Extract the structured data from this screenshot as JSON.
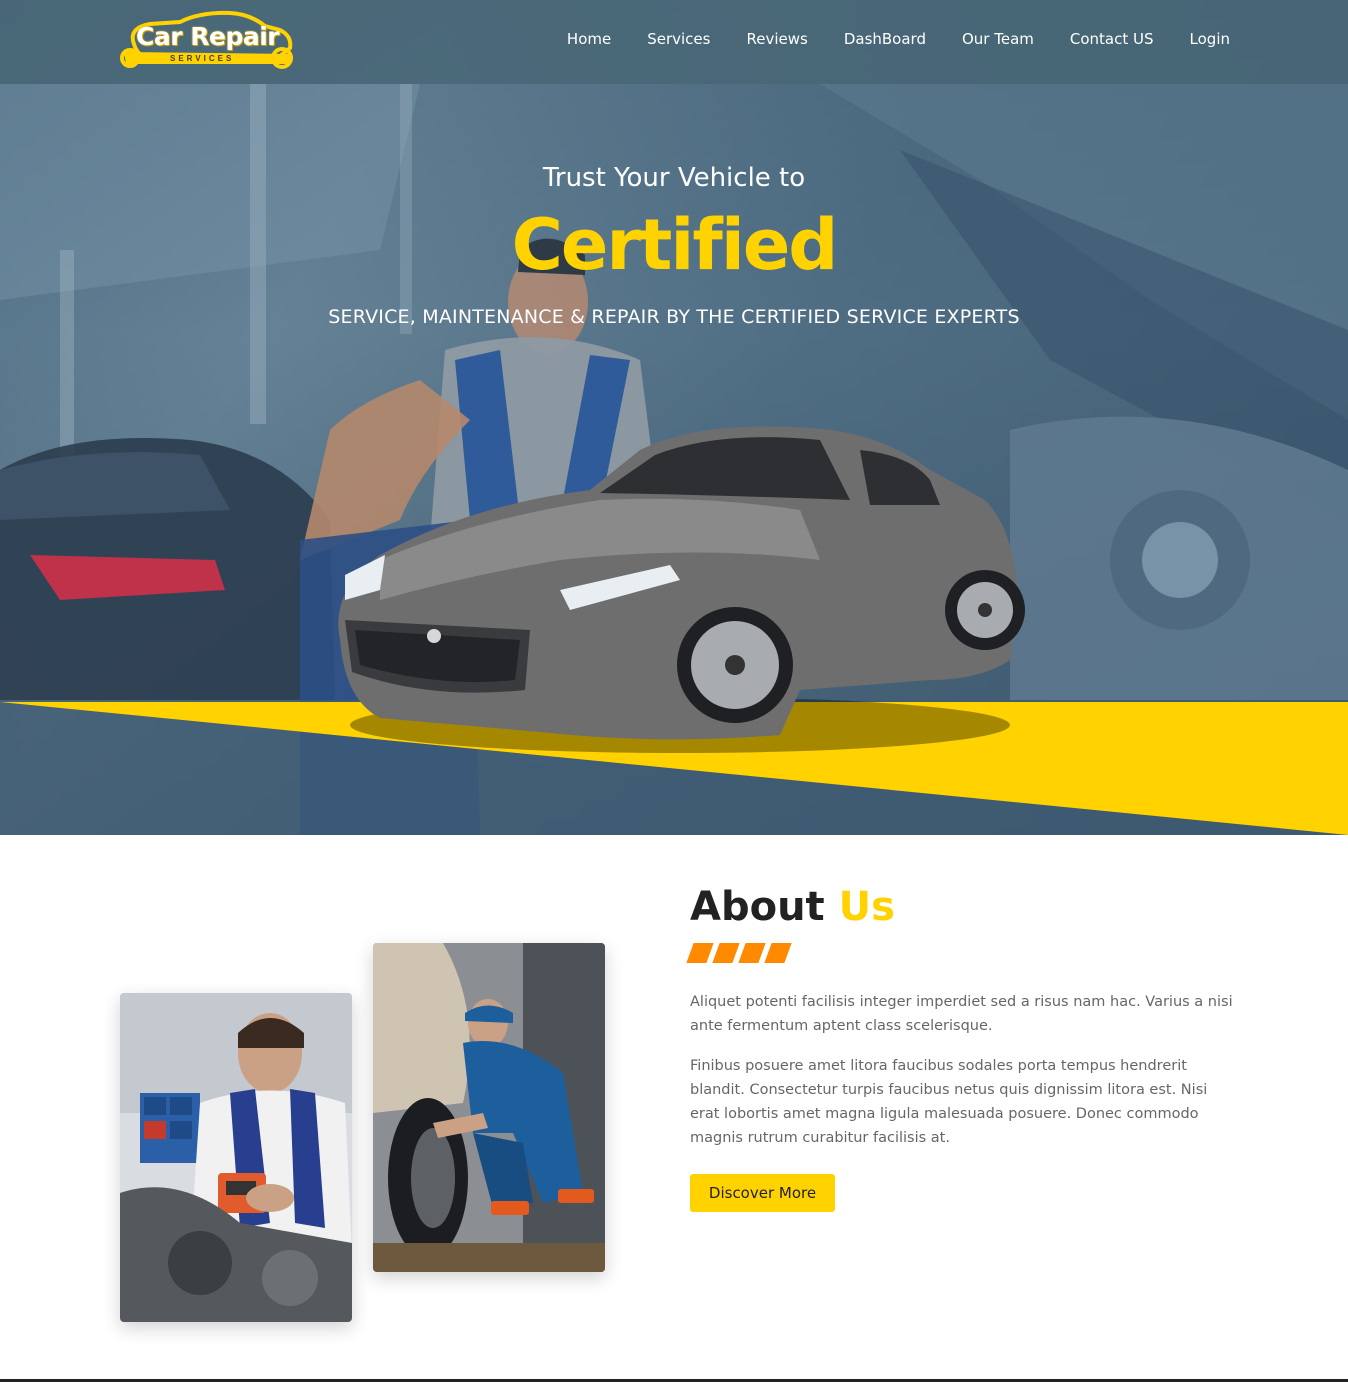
{
  "brand": {
    "name": "Car Repair",
    "sub": "SERVICES",
    "accent_color": "#ffd200",
    "stripe_color": "#ff8a00"
  },
  "nav": {
    "items": [
      {
        "label": "Home"
      },
      {
        "label": "Services"
      },
      {
        "label": "Reviews"
      },
      {
        "label": "DashBoard"
      },
      {
        "label": "Our Team"
      },
      {
        "label": "Contact US"
      },
      {
        "label": "Login"
      }
    ]
  },
  "hero": {
    "subtitle": "Trust Your Vehicle to",
    "title": "Certified",
    "tagline": "SERVICE, MAINTENANCE & REPAIR BY THE CERTIFIED SERVICE EXPERTS"
  },
  "about": {
    "heading_main": "About",
    "heading_accent": "Us",
    "paragraph_1": "Aliquet potenti facilisis integer imperdiet sed a risus nam hac. Varius a nisi ante fermentum aptent class scelerisque.",
    "paragraph_2": "Finibus posuere amet litora faucibus sodales porta tempus hendrerit blandit. Consectetur turpis faucibus netus quis dignissim litora est. Nisi erat lobortis amet magna ligula malesuada posuere. Donec commodo magnis rutrum curabitur facilisis at.",
    "button_label": "Discover More"
  }
}
